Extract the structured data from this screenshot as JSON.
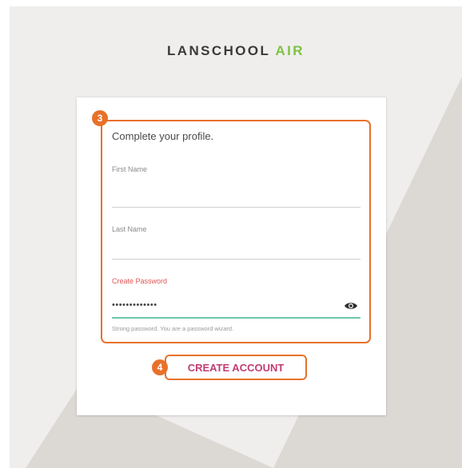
{
  "logo": {
    "main": "LANSCHOOL",
    "accent": "AIR"
  },
  "callouts": {
    "profile": "3",
    "create": "4"
  },
  "form": {
    "heading": "Complete your profile.",
    "first_name": {
      "label": "First Name",
      "value": ""
    },
    "last_name": {
      "label": "Last Name",
      "value": ""
    },
    "password": {
      "label": "Create Password",
      "value": "•••••••••••••",
      "hint": "Strong password. You are a password wizard."
    },
    "create_button": "CREATE ACCOUNT"
  },
  "icons": {
    "show_password": "eye-icon"
  },
  "colors": {
    "accent_green": "#7dc241",
    "callout_orange": "#e8712a",
    "button_text": "#c23b72",
    "error_label": "#e05555",
    "valid_underline": "#6fc6ad"
  }
}
